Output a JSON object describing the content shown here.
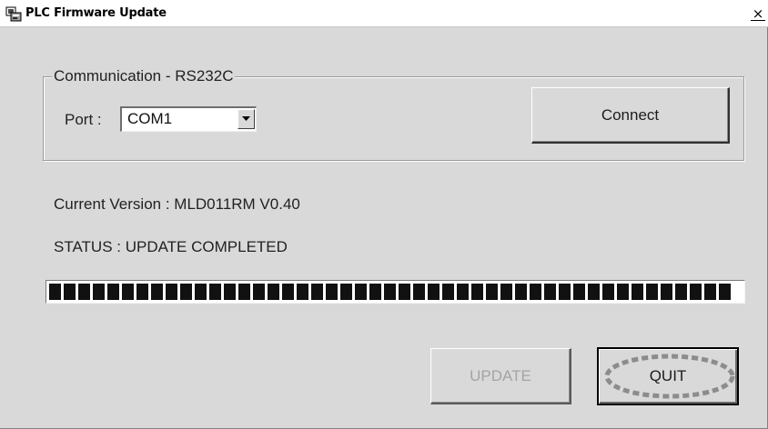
{
  "window": {
    "title": "PLC Firmware Update",
    "close_symbol": "×",
    "app_icon": "plc-app-icon",
    "background_color": "#d9d9d9"
  },
  "communication": {
    "group_title": "Communication - RS232C",
    "port_label": "Port :",
    "port_value": "COM1",
    "connect_label": "Connect"
  },
  "info": {
    "current_version": "Current Version : MLD011RM V0.40",
    "status": "STATUS : UPDATE COMPLETED"
  },
  "progress": {
    "percent": 100,
    "fill_color": "#111111"
  },
  "actions": {
    "update_label": "UPDATE",
    "update_enabled": false,
    "quit_label": "QUIT",
    "quit_highlight": "dotted-ellipse",
    "highlight_color": "#8c8c8c"
  }
}
